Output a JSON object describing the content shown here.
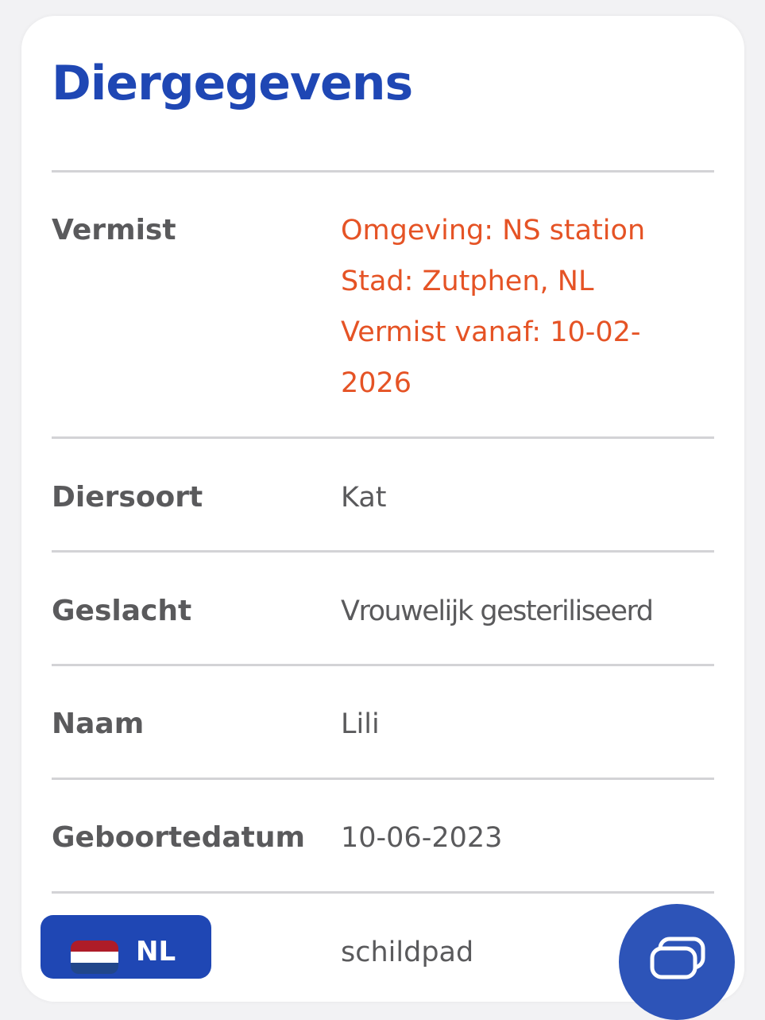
{
  "header": {
    "title": "Diergegevens"
  },
  "details": [
    {
      "label": "Vermist",
      "lines": [
        "Omgeving: NS station",
        "Stad: Zutphen, NL",
        "Vermist vanaf: 10-02-",
        "2026"
      ]
    },
    {
      "label": "Diersoort",
      "value": "Kat"
    },
    {
      "label": "Geslacht",
      "value": "Vrouwelijk gesteriliseerd"
    },
    {
      "label": "Naam",
      "value": "Lili"
    },
    {
      "label": "Geboortedatum",
      "value": "10-06-2023"
    },
    {
      "label": "",
      "value": "schildpad"
    }
  ],
  "language_switcher": {
    "label": "NL",
    "icon": "netherlands-flag-icon"
  },
  "chat": {
    "icon": "chat-icon"
  },
  "colors": {
    "title": "#1f47b4",
    "alert_text": "#e55325",
    "body_text": "#5a5a5c",
    "divider": "#d3d3d6",
    "button_bg": "#1f47b4"
  }
}
